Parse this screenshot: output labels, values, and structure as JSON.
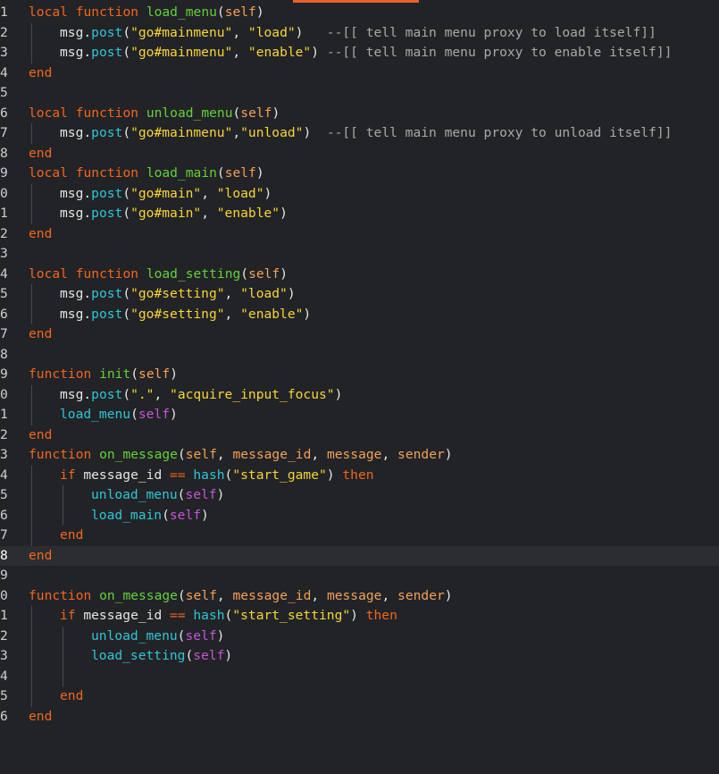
{
  "editor": {
    "accent_color": "#e8602c",
    "current_line": 28,
    "lines": [
      {
        "n": "1",
        "indent": 0,
        "tokens": [
          [
            "kw",
            "local"
          ],
          [
            "plain",
            " "
          ],
          [
            "kw",
            "function"
          ],
          [
            "plain",
            " "
          ],
          [
            "fn",
            "load_menu"
          ],
          [
            "punc",
            "("
          ],
          [
            "param",
            "self"
          ],
          [
            "punc",
            ")"
          ]
        ]
      },
      {
        "n": "2",
        "indent": 1,
        "tokens": [
          [
            "plain",
            "msg"
          ],
          [
            "punc",
            "."
          ],
          [
            "call",
            "post"
          ],
          [
            "punc",
            "("
          ],
          [
            "str",
            "\"go#mainmenu\""
          ],
          [
            "punc",
            ", "
          ],
          [
            "str",
            "\"load\""
          ],
          [
            "punc",
            ")"
          ],
          [
            "plain",
            "   "
          ],
          [
            "cmt",
            "--[[ tell main menu proxy to load itself]]"
          ]
        ]
      },
      {
        "n": "3",
        "indent": 1,
        "tokens": [
          [
            "plain",
            "msg"
          ],
          [
            "punc",
            "."
          ],
          [
            "call",
            "post"
          ],
          [
            "punc",
            "("
          ],
          [
            "str",
            "\"go#mainmenu\""
          ],
          [
            "punc",
            ", "
          ],
          [
            "str",
            "\"enable\""
          ],
          [
            "punc",
            ")"
          ],
          [
            "plain",
            " "
          ],
          [
            "cmt",
            "--[[ tell main menu proxy to enable itself]]"
          ]
        ]
      },
      {
        "n": "4",
        "indent": 0,
        "tokens": [
          [
            "kw",
            "end"
          ]
        ]
      },
      {
        "n": "5",
        "indent": 0,
        "tokens": []
      },
      {
        "n": "6",
        "indent": 0,
        "tokens": [
          [
            "kw",
            "local"
          ],
          [
            "plain",
            " "
          ],
          [
            "kw",
            "function"
          ],
          [
            "plain",
            " "
          ],
          [
            "fn",
            "unload_menu"
          ],
          [
            "punc",
            "("
          ],
          [
            "param",
            "self"
          ],
          [
            "punc",
            ")"
          ]
        ]
      },
      {
        "n": "7",
        "indent": 1,
        "tokens": [
          [
            "plain",
            "msg"
          ],
          [
            "punc",
            "."
          ],
          [
            "call",
            "post"
          ],
          [
            "punc",
            "("
          ],
          [
            "str",
            "\"go#mainmenu\""
          ],
          [
            "punc",
            ","
          ],
          [
            "str",
            "\"unload\""
          ],
          [
            "punc",
            ")"
          ],
          [
            "plain",
            "  "
          ],
          [
            "cmt",
            "--[[ tell main menu proxy to unload itself]]"
          ]
        ]
      },
      {
        "n": "8",
        "indent": 0,
        "tokens": [
          [
            "kw",
            "end"
          ]
        ]
      },
      {
        "n": "9",
        "indent": 0,
        "tokens": [
          [
            "kw",
            "local"
          ],
          [
            "plain",
            " "
          ],
          [
            "kw",
            "function"
          ],
          [
            "plain",
            " "
          ],
          [
            "fn",
            "load_main"
          ],
          [
            "punc",
            "("
          ],
          [
            "param",
            "self"
          ],
          [
            "punc",
            ")"
          ]
        ]
      },
      {
        "n": "0",
        "indent": 1,
        "tokens": [
          [
            "plain",
            "msg"
          ],
          [
            "punc",
            "."
          ],
          [
            "call",
            "post"
          ],
          [
            "punc",
            "("
          ],
          [
            "str",
            "\"go#main\""
          ],
          [
            "punc",
            ", "
          ],
          [
            "str",
            "\"load\""
          ],
          [
            "punc",
            ")"
          ]
        ]
      },
      {
        "n": "1",
        "indent": 1,
        "tokens": [
          [
            "plain",
            "msg"
          ],
          [
            "punc",
            "."
          ],
          [
            "call",
            "post"
          ],
          [
            "punc",
            "("
          ],
          [
            "str",
            "\"go#main\""
          ],
          [
            "punc",
            ", "
          ],
          [
            "str",
            "\"enable\""
          ],
          [
            "punc",
            ")"
          ]
        ]
      },
      {
        "n": "2",
        "indent": 0,
        "tokens": [
          [
            "kw",
            "end"
          ]
        ]
      },
      {
        "n": "3",
        "indent": 0,
        "tokens": []
      },
      {
        "n": "4",
        "indent": 0,
        "tokens": [
          [
            "kw",
            "local"
          ],
          [
            "plain",
            " "
          ],
          [
            "kw",
            "function"
          ],
          [
            "plain",
            " "
          ],
          [
            "fn",
            "load_setting"
          ],
          [
            "punc",
            "("
          ],
          [
            "param",
            "self"
          ],
          [
            "punc",
            ")"
          ]
        ]
      },
      {
        "n": "5",
        "indent": 1,
        "tokens": [
          [
            "plain",
            "msg"
          ],
          [
            "punc",
            "."
          ],
          [
            "call",
            "post"
          ],
          [
            "punc",
            "("
          ],
          [
            "str",
            "\"go#setting\""
          ],
          [
            "punc",
            ", "
          ],
          [
            "str",
            "\"load\""
          ],
          [
            "punc",
            ")"
          ]
        ]
      },
      {
        "n": "6",
        "indent": 1,
        "tokens": [
          [
            "plain",
            "msg"
          ],
          [
            "punc",
            "."
          ],
          [
            "call",
            "post"
          ],
          [
            "punc",
            "("
          ],
          [
            "str",
            "\"go#setting\""
          ],
          [
            "punc",
            ", "
          ],
          [
            "str",
            "\"enable\""
          ],
          [
            "punc",
            ")"
          ]
        ]
      },
      {
        "n": "7",
        "indent": 0,
        "tokens": [
          [
            "kw",
            "end"
          ]
        ]
      },
      {
        "n": "8",
        "indent": 0,
        "tokens": []
      },
      {
        "n": "9",
        "indent": 0,
        "tokens": [
          [
            "kw",
            "function"
          ],
          [
            "plain",
            " "
          ],
          [
            "fn",
            "init"
          ],
          [
            "punc",
            "("
          ],
          [
            "param",
            "self"
          ],
          [
            "punc",
            ")"
          ]
        ]
      },
      {
        "n": "0",
        "indent": 1,
        "tokens": [
          [
            "plain",
            "msg"
          ],
          [
            "punc",
            "."
          ],
          [
            "call",
            "post"
          ],
          [
            "punc",
            "("
          ],
          [
            "str",
            "\".\""
          ],
          [
            "punc",
            ", "
          ],
          [
            "str",
            "\"acquire_input_focus\""
          ],
          [
            "punc",
            ")"
          ]
        ]
      },
      {
        "n": "1",
        "indent": 1,
        "tokens": [
          [
            "call",
            "load_menu"
          ],
          [
            "punc",
            "("
          ],
          [
            "self",
            "self"
          ],
          [
            "punc",
            ")"
          ]
        ]
      },
      {
        "n": "2",
        "indent": 0,
        "tokens": [
          [
            "kw",
            "end"
          ]
        ]
      },
      {
        "n": "3",
        "indent": 0,
        "tokens": [
          [
            "kw",
            "function"
          ],
          [
            "plain",
            " "
          ],
          [
            "fn",
            "on_message"
          ],
          [
            "punc",
            "("
          ],
          [
            "param",
            "self"
          ],
          [
            "punc",
            ", "
          ],
          [
            "param",
            "message_id"
          ],
          [
            "punc",
            ", "
          ],
          [
            "param",
            "message"
          ],
          [
            "punc",
            ", "
          ],
          [
            "param",
            "sender"
          ],
          [
            "punc",
            ")"
          ]
        ]
      },
      {
        "n": "4",
        "indent": 1,
        "tokens": [
          [
            "kw",
            "if"
          ],
          [
            "plain",
            " message_id "
          ],
          [
            "op",
            "=="
          ],
          [
            "plain",
            " "
          ],
          [
            "call",
            "hash"
          ],
          [
            "punc",
            "("
          ],
          [
            "str",
            "\"start_game\""
          ],
          [
            "punc",
            ")"
          ],
          [
            "plain",
            " "
          ],
          [
            "kw",
            "then"
          ]
        ]
      },
      {
        "n": "5",
        "indent": 2,
        "tokens": [
          [
            "call",
            "unload_menu"
          ],
          [
            "punc",
            "("
          ],
          [
            "self",
            "self"
          ],
          [
            "punc",
            ")"
          ]
        ]
      },
      {
        "n": "6",
        "indent": 2,
        "tokens": [
          [
            "call",
            "load_main"
          ],
          [
            "punc",
            "("
          ],
          [
            "self",
            "self"
          ],
          [
            "punc",
            ")"
          ]
        ]
      },
      {
        "n": "7",
        "indent": 1,
        "tokens": [
          [
            "kw",
            "end"
          ]
        ]
      },
      {
        "n": "8",
        "indent": 0,
        "tokens": [
          [
            "kw",
            "end"
          ]
        ]
      },
      {
        "n": "9",
        "indent": 0,
        "tokens": []
      },
      {
        "n": "0",
        "indent": 0,
        "tokens": [
          [
            "kw",
            "function"
          ],
          [
            "plain",
            " "
          ],
          [
            "fn",
            "on_message"
          ],
          [
            "punc",
            "("
          ],
          [
            "param",
            "self"
          ],
          [
            "punc",
            ", "
          ],
          [
            "param",
            "message_id"
          ],
          [
            "punc",
            ", "
          ],
          [
            "param",
            "message"
          ],
          [
            "punc",
            ", "
          ],
          [
            "param",
            "sender"
          ],
          [
            "punc",
            ")"
          ]
        ]
      },
      {
        "n": "1",
        "indent": 1,
        "tokens": [
          [
            "kw",
            "if"
          ],
          [
            "plain",
            " message_id "
          ],
          [
            "op",
            "=="
          ],
          [
            "plain",
            " "
          ],
          [
            "call",
            "hash"
          ],
          [
            "punc",
            "("
          ],
          [
            "str",
            "\"start_setting\""
          ],
          [
            "punc",
            ")"
          ],
          [
            "plain",
            " "
          ],
          [
            "kw",
            "then"
          ]
        ]
      },
      {
        "n": "2",
        "indent": 2,
        "tokens": [
          [
            "call",
            "unload_menu"
          ],
          [
            "punc",
            "("
          ],
          [
            "self",
            "self"
          ],
          [
            "punc",
            ")"
          ]
        ]
      },
      {
        "n": "3",
        "indent": 2,
        "tokens": [
          [
            "call",
            "load_setting"
          ],
          [
            "punc",
            "("
          ],
          [
            "self",
            "self"
          ],
          [
            "punc",
            ")"
          ]
        ]
      },
      {
        "n": "4",
        "indent": 2,
        "tokens": []
      },
      {
        "n": "5",
        "indent": 1,
        "tokens": [
          [
            "kw",
            "end"
          ]
        ]
      },
      {
        "n": "6",
        "indent": 0,
        "tokens": [
          [
            "kw",
            "end"
          ]
        ]
      }
    ]
  }
}
